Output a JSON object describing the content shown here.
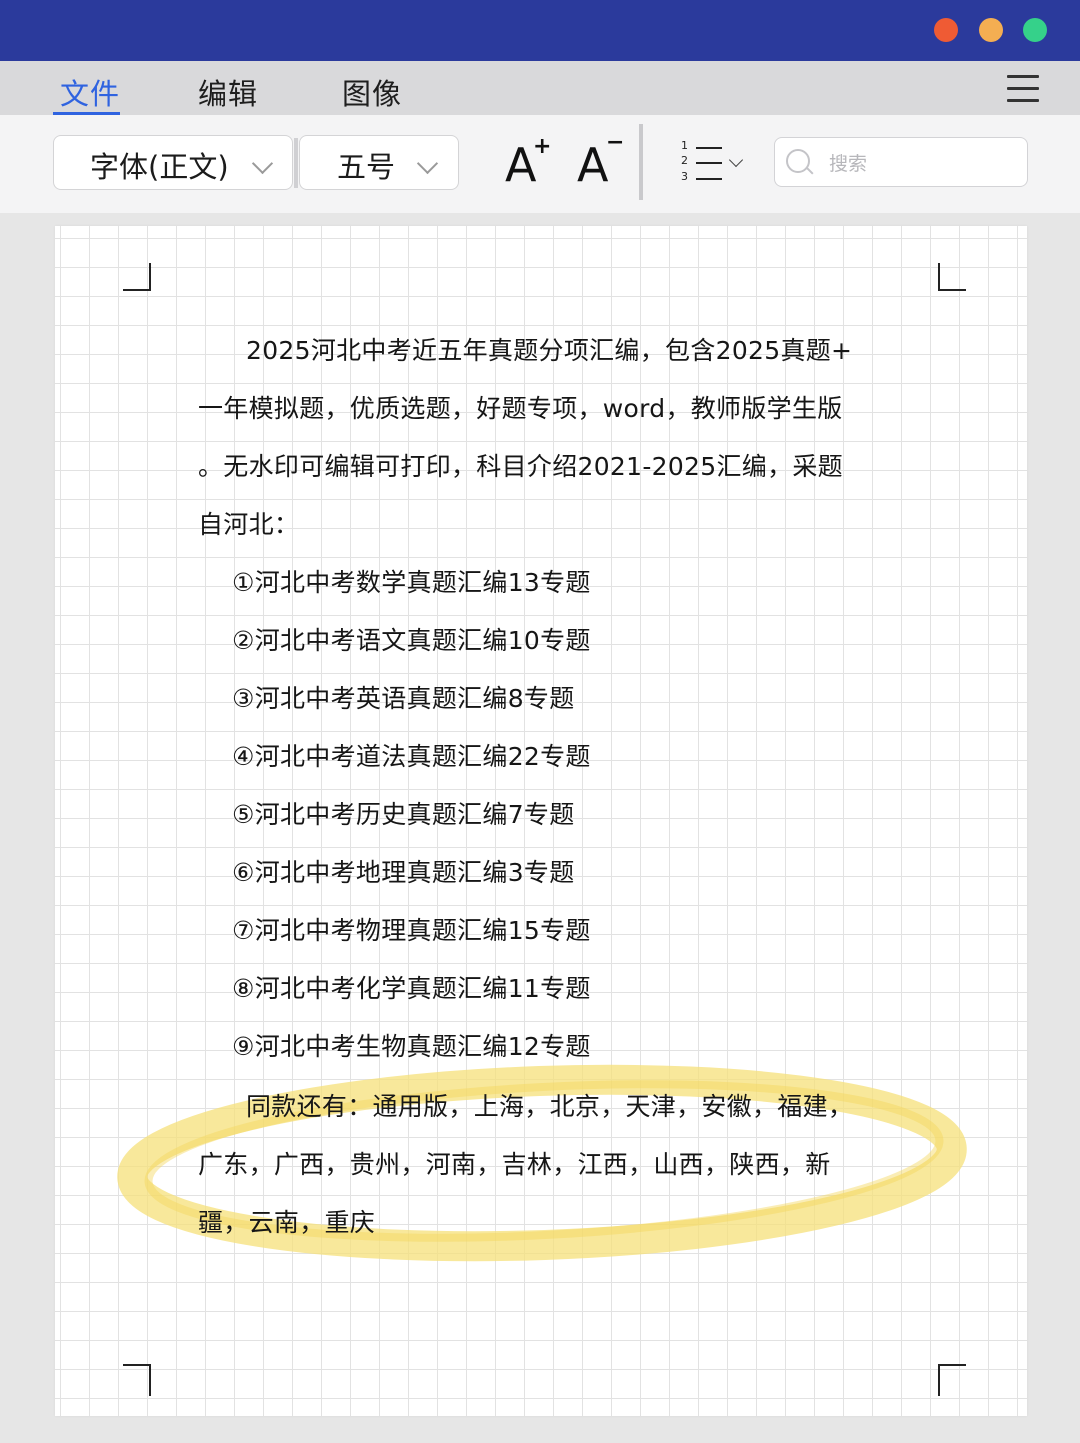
{
  "menu": {
    "items": [
      "文件",
      "编辑",
      "图像"
    ]
  },
  "toolbar": {
    "font_family": "字体(正文)",
    "font_size": "五号",
    "increase_font_label": "A",
    "decrease_font_label": "A",
    "list_numbers": [
      "1",
      "2",
      "3"
    ],
    "search_placeholder": "搜索"
  },
  "document": {
    "intro_lines": [
      "2025河北中考近五年真题分项汇编，包含2025真题+",
      "一年模拟题，优质选题，好题专项，word，教师版学生版",
      "。无水印可编辑可打印，科目介绍2021-2025汇编，采题",
      "自河北："
    ],
    "subjects": [
      "①河北中考数学真题汇编13专题",
      "②河北中考语文真题汇编10专题",
      "③河北中考英语真题汇编8专题",
      "④河北中考道法真题汇编22专题",
      "⑤河北中考历史真题汇编7专题",
      "⑥河北中考地理真题汇编3专题",
      "⑦河北中考物理真题汇编15专题",
      "⑧河北中考化学真题汇编11专题",
      "⑨河北中考生物真题汇编12专题"
    ],
    "also_lines": [
      "同款还有：通用版，上海，北京，天津，安徽，福建，",
      "广东，广西，贵州，河南，吉林，江西，山西，陕西，新",
      "疆，云南，重庆"
    ]
  },
  "colors": {
    "titlebar": "#2b3a9c",
    "accent": "#2f63e0",
    "highlight_stroke": "#f6e07a",
    "window_close": "#ef5b34",
    "window_minimize": "#f4ae52",
    "window_maximize": "#35d18a"
  },
  "icons": [
    "close-dot",
    "minimize-dot",
    "maximize-dot",
    "hamburger-menu-icon",
    "chevron-down-icon",
    "increase-font-icon",
    "decrease-font-icon",
    "numbered-list-icon",
    "search-icon"
  ]
}
